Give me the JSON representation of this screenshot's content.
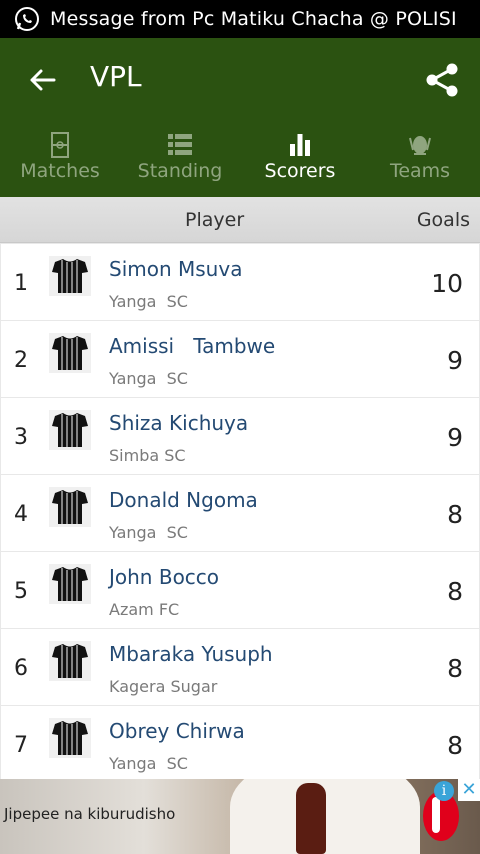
{
  "status_bar": {
    "notification": "Message from Pc Matiku Chacha @ POLISI"
  },
  "app_bar": {
    "title": "VPL"
  },
  "tabs": [
    {
      "label": "Matches",
      "icon": "pitch-icon",
      "active": false
    },
    {
      "label": "Standing",
      "icon": "list-icon",
      "active": false
    },
    {
      "label": "Scorers",
      "icon": "bar-chart-icon",
      "active": true
    },
    {
      "label": "Teams",
      "icon": "crest-icon",
      "active": false
    }
  ],
  "table_header": {
    "player": "Player",
    "goals": "Goals"
  },
  "scorers": [
    {
      "rank": "1",
      "name": "Simon Msuva",
      "team": "Yanga  SC",
      "goals": "10"
    },
    {
      "rank": "2",
      "name": "Amissi   Tambwe",
      "team": "Yanga  SC",
      "goals": "9"
    },
    {
      "rank": "3",
      "name": "Shiza Kichuya",
      "team": "Simba SC",
      "goals": "9"
    },
    {
      "rank": "4",
      "name": "Donald Ngoma",
      "team": "Yanga  SC",
      "goals": "8"
    },
    {
      "rank": "5",
      "name": "John Bocco",
      "team": "Azam FC",
      "goals": "8"
    },
    {
      "rank": "6",
      "name": "Mbaraka Yusuph",
      "team": "Kagera Sugar",
      "goals": "8"
    },
    {
      "rank": "7",
      "name": "Obrey Chirwa",
      "team": "Yanga  SC",
      "goals": "8"
    }
  ],
  "ad": {
    "text": "Jipepee na kiburudisho",
    "info_label": "i",
    "close_label": "✕"
  },
  "colors": {
    "app_bar": "#2b5211",
    "name_text": "#244a73",
    "inactive_tab": "#8fa57f"
  }
}
